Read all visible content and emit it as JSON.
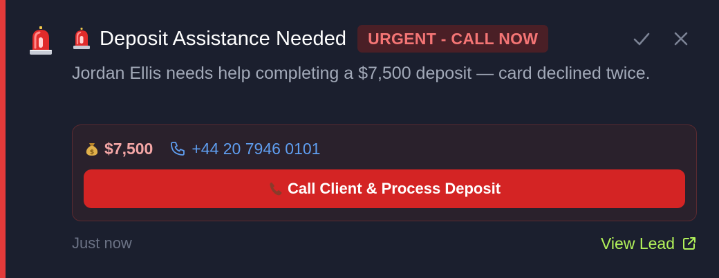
{
  "notification": {
    "title": "Deposit Assistance Needed",
    "badge": "URGENT - CALL NOW",
    "message": "Jordan Ellis needs help completing a $7,500 deposit — card declined twice.",
    "amount": "$7,500",
    "phone": "+44 20 7946 0101",
    "call_button_label": "Call Client & Process Deposit",
    "timestamp": "Just now",
    "view_lead_label": "View Lead"
  },
  "icons": {
    "leading": "siren-emoji-icon",
    "title": "siren-emoji-icon",
    "mark_read": "check-icon",
    "dismiss": "close-icon",
    "amount": "money-bag-icon",
    "phone": "phone-icon",
    "call_button": "telephone-receiver-icon",
    "view_lead": "external-link-icon"
  },
  "colors": {
    "background": "#1b1f2e",
    "accent_bar": "#e43a3a",
    "badge_background": "#4a1f26",
    "badge_text": "#f47575",
    "amount_text": "#f4a6a6",
    "phone_text": "#5f9ef0",
    "call_button": "#d42424",
    "view_lead_text": "#b2f25a",
    "message_text": "#a2a9b8",
    "timestamp_text": "#6b7285"
  }
}
